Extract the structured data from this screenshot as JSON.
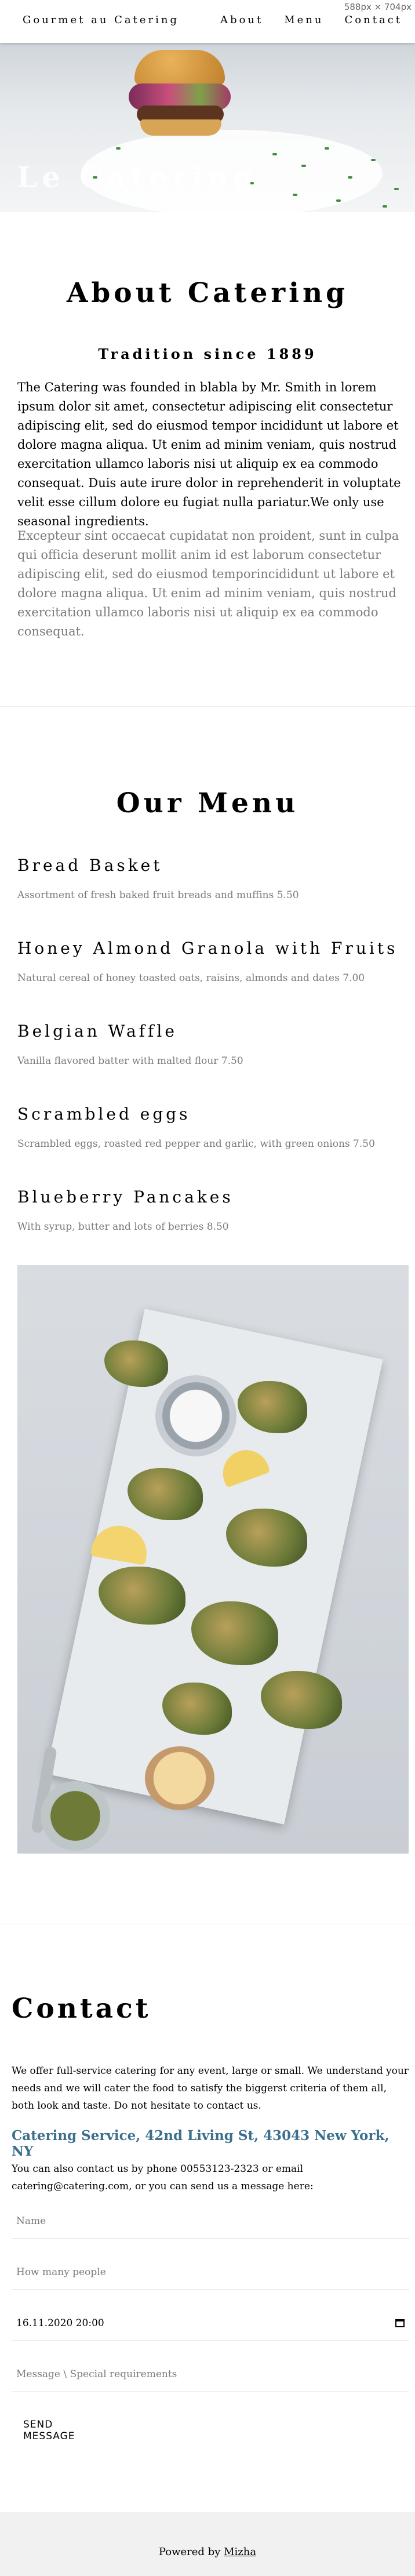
{
  "nav": {
    "brand": "Gourmet au Catering",
    "links": [
      "About",
      "Menu",
      "Contact"
    ],
    "dims_badge": "588px × 704px"
  },
  "hero": {
    "title": "Le Catering"
  },
  "about": {
    "title": "About Catering",
    "subtitle": "Tradition since 1889",
    "paragraph1": "The Catering was founded in blabla by Mr. Smith in lorem ipsum dolor sit amet, consectetur adipiscing elit consectetur adipiscing elit, sed do eiusmod tempor incididunt ut labore et dolore magna aliqua. Ut enim ad minim veniam, quis nostrud exercitation ullamco laboris nisi ut aliquip ex ea commodo consequat. Duis aute irure dolor in reprehenderit in voluptate velit esse cillum dolore eu fugiat nulla pariatur.We only use seasonal ingredients.",
    "paragraph2": "Excepteur sint occaecat cupidatat non proident, sunt in culpa qui officia deserunt mollit anim id est laborum consectetur adipiscing elit, sed do eiusmod temporincididunt ut labore et dolore magna aliqua. Ut enim ad minim veniam, quis nostrud exercitation ullamco laboris nisi ut aliquip ex ea commodo consequat."
  },
  "menu": {
    "title": "Our Menu",
    "items": [
      {
        "name": "Bread Basket",
        "desc": "Assortment of fresh baked fruit breads and muffins 5.50"
      },
      {
        "name": "Honey Almond Granola with Fruits",
        "desc": "Natural cereal of honey toasted oats, raisins, almonds and dates 7.00"
      },
      {
        "name": "Belgian Waffle",
        "desc": "Vanilla flavored batter with malted flour 7.50"
      },
      {
        "name": "Scrambled eggs",
        "desc": "Scrambled eggs, roasted red pepper and garlic, with green onions 7.50"
      },
      {
        "name": "Blueberry Pancakes",
        "desc": "With syrup, butter and lots of berries 8.50"
      }
    ]
  },
  "contact": {
    "title": "Contact",
    "paragraph1": "We offer full-service catering for any event, large or small. We understand your needs and we will cater the food to satisfy the biggerst criteria of them all, both look and taste. Do not hesitate to contact us.",
    "address": "Catering Service, 42nd Living St, 43043 New York, NY",
    "paragraph2": "You can also contact us by phone 00553123-2323 or email catering@catering.com, or you can send us a message here:",
    "form": {
      "name_placeholder": "Name",
      "people_placeholder": "How many people",
      "datetime_value": "16.11.2020 20:00",
      "message_placeholder": "Message \\ Special requirements",
      "submit_label": "SEND MESSAGE"
    }
  },
  "footer": {
    "prefix": "Powered by ",
    "link": "Mizha"
  }
}
